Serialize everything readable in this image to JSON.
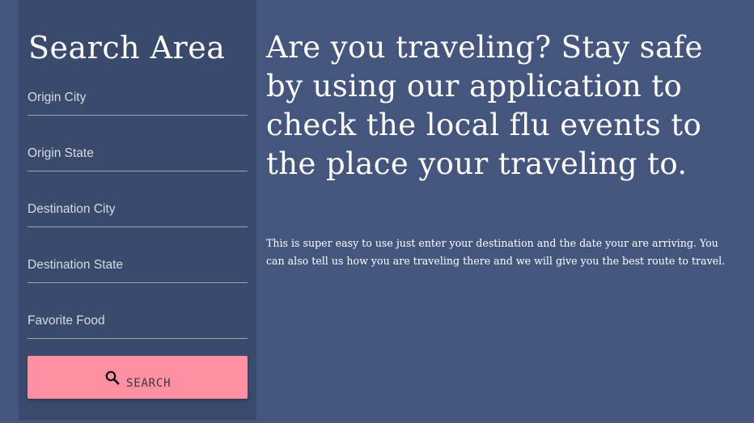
{
  "sidebar": {
    "title": "Search Area",
    "fields": [
      {
        "label": "Origin City"
      },
      {
        "label": "Origin State"
      },
      {
        "label": "Destination City"
      },
      {
        "label": "Destination State"
      },
      {
        "label": "Favorite Food"
      }
    ],
    "search_button": {
      "label": "SEARCH",
      "icon": "search-icon",
      "color": "#ff8fa3"
    }
  },
  "main": {
    "headline": "Are you traveling? Stay safe by using our application to check the local flu events to the place your traveling to.",
    "description": "This is super easy to use just enter your destination and the date your are arriving. You can also tell us how you are traveling there and we will give you the best route to travel."
  },
  "colors": {
    "background": "#44567d",
    "sidebar_background": "#3a4a6c",
    "accent": "#ff8fa3"
  }
}
